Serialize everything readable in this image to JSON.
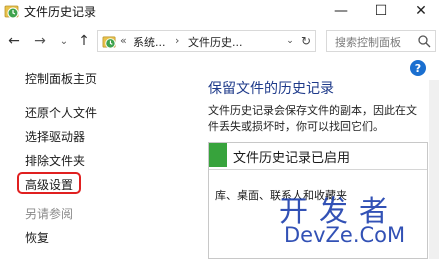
{
  "window": {
    "title": "文件历史记录",
    "minimize": "—",
    "maximize": "☐",
    "close": "✕"
  },
  "nav": {
    "back": "←",
    "forward": "→",
    "recent": "⌄",
    "up": "↑",
    "address": {
      "prefix": "«",
      "seg1": "系统...",
      "sep": "›",
      "seg2": "文件历史...",
      "dropdown": "⌄",
      "refresh": "↻"
    },
    "search_placeholder": "搜索控制面板"
  },
  "help": "?",
  "sidebar": {
    "home": "控制面板主页",
    "items": [
      "还原个人文件",
      "选择驱动器",
      "排除文件夹",
      "高级设置"
    ],
    "see_also": "另请参阅",
    "recover": "恢复"
  },
  "main": {
    "title": "保留文件的历史记录",
    "description": "文件历史记录会保存文件的副本，因此在文件丢失或损坏时，你可以找回它们。",
    "status": {
      "heading": "文件历史记录已启用",
      "body": "库、桌面、联系人和收藏夹"
    }
  },
  "watermark": {
    "cn": "开发者",
    "en": "DevZe.CoM"
  },
  "colors": {
    "status_green": "#37a33c",
    "title_blue": "#1e3a8a",
    "highlight_red": "#e02020",
    "watermark_blue": "#1c3fae"
  }
}
